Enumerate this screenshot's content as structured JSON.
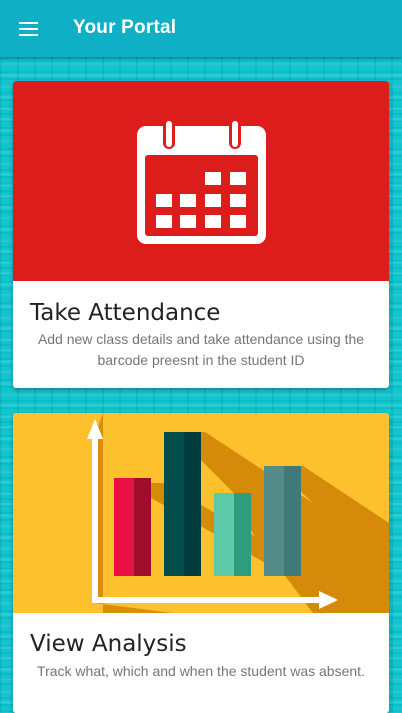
{
  "app": {
    "title": "Your Portal",
    "menu_icon": "hamburger-menu-icon",
    "bar_color": "#0fb0c6"
  },
  "cards": [
    {
      "title": "Take Attendance",
      "description": "Add new class details and take attendance using the barcode preesnt in the student ID",
      "icon": "calendar-icon",
      "hero_color": "#dd1c1c"
    },
    {
      "title": "View Analysis",
      "description": "Track what, which and when the student was absent.",
      "icon": "bar-chart-illustration",
      "hero_color": "#fcc12d"
    }
  ]
}
